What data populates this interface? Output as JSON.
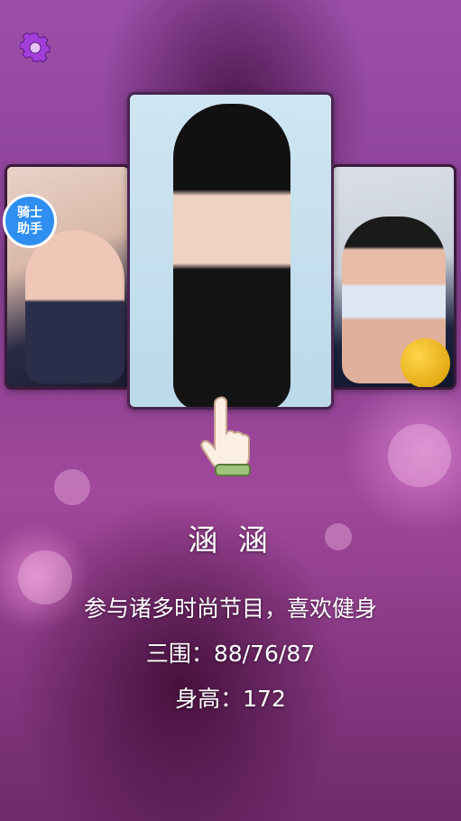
{
  "badge": {
    "line1": "骑士",
    "line2": "助手"
  },
  "profile": {
    "name": "涵 涵",
    "description": "参与诸多时尚节目，喜欢健身",
    "measurements": "三围：88/76/87",
    "height": "身高：172"
  },
  "icons": {
    "settings": "gear-icon",
    "pointer": "pointing-hand-icon"
  },
  "colors": {
    "accent": "#9b3fd0",
    "badge": "#2f8ff0",
    "text": "#ffffff"
  }
}
